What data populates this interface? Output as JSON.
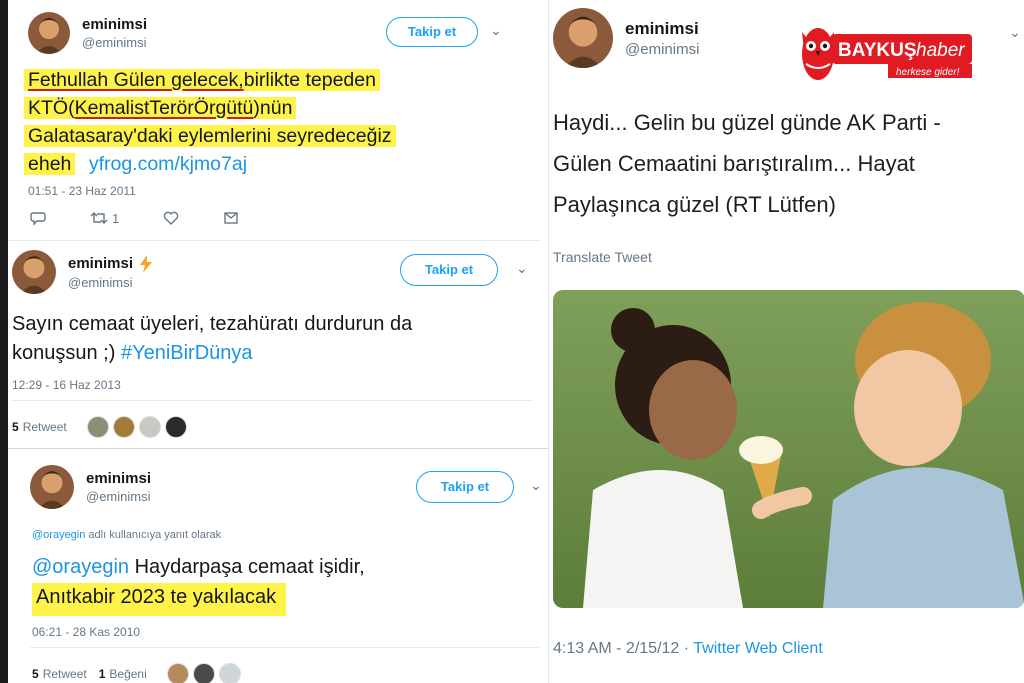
{
  "colors": {
    "highlight": "#fff34a",
    "underline_red": "#d11f1f",
    "twitter_blue": "#1da1f2",
    "link_blue": "#1b95e0",
    "logo_red": "#e01b22"
  },
  "tweet1": {
    "name": "eminimsi",
    "handle": "@eminimsi",
    "follow_label": "Takip et",
    "text": {
      "part_ul1": "Fethullah Gülen gelecek,",
      "part_plain1": "birlikte tepeden",
      "part_kto": "KTÖ(",
      "part_ul2": "KemalistTerörÖrgütü",
      "part_after": ")nün",
      "line3": "Galatasaray'daki eylemlerini seyredeceğiz",
      "line4": "eheh",
      "link": "yfrog.com/kjmo7aj"
    },
    "timestamp": "01:51 - 23 Haz 2011",
    "retweet_count": "1",
    "icons": [
      "reply-icon",
      "retweet-icon",
      "like-icon",
      "message-icon"
    ]
  },
  "tweet2": {
    "name": "eminimsi",
    "badge_icon": "lightning-icon",
    "handle": "@eminimsi",
    "follow_label": "Takip et",
    "text_line1": "Sayın cemaat üyeleri, tezahüratı durdurun da",
    "text_line2_plain": "konuşsun ;) ",
    "hashtag": "#YeniBirDünya",
    "timestamp": "12:29 - 16 Haz 2013",
    "retweets_num": "5",
    "retweets_label": "Retweet"
  },
  "tweet3": {
    "name": "eminimsi",
    "handle": "@eminimsi",
    "follow_label": "Takip et",
    "reply_to_handle": "@orayegin",
    "reply_to_suffix": " adlı kullanıcıya yanıt olarak",
    "mention": "@orayegin",
    "text_line1_rest": " Haydarpaşa cemaat işidir,",
    "text_line2": "Anıtkabir 2023 te yakılacak",
    "timestamp": "06:21 - 28 Kas 2010",
    "retweets_num": "5",
    "retweets_label": "Retweet",
    "likes_num": "1",
    "likes_label": "Beğeni"
  },
  "tweet4": {
    "name": "eminimsi",
    "handle": "@eminimsi",
    "text_line1": "Haydi... Gelin bu güzel günde AK Parti -",
    "text_line2": "Gülen Cemaatini barıştıralım... Hayat",
    "text_line3": "Paylaşınca güzel  (RT Lütfen)",
    "translate_label": "Translate Tweet",
    "timestamp": "4:13 AM - 2/15/12",
    "separator": " · ",
    "client": "Twitter Web Client"
  },
  "logo": {
    "brand_bold": "BAYKUŞ",
    "brand_rest": "haber",
    "tagline": "herkese gider!"
  }
}
